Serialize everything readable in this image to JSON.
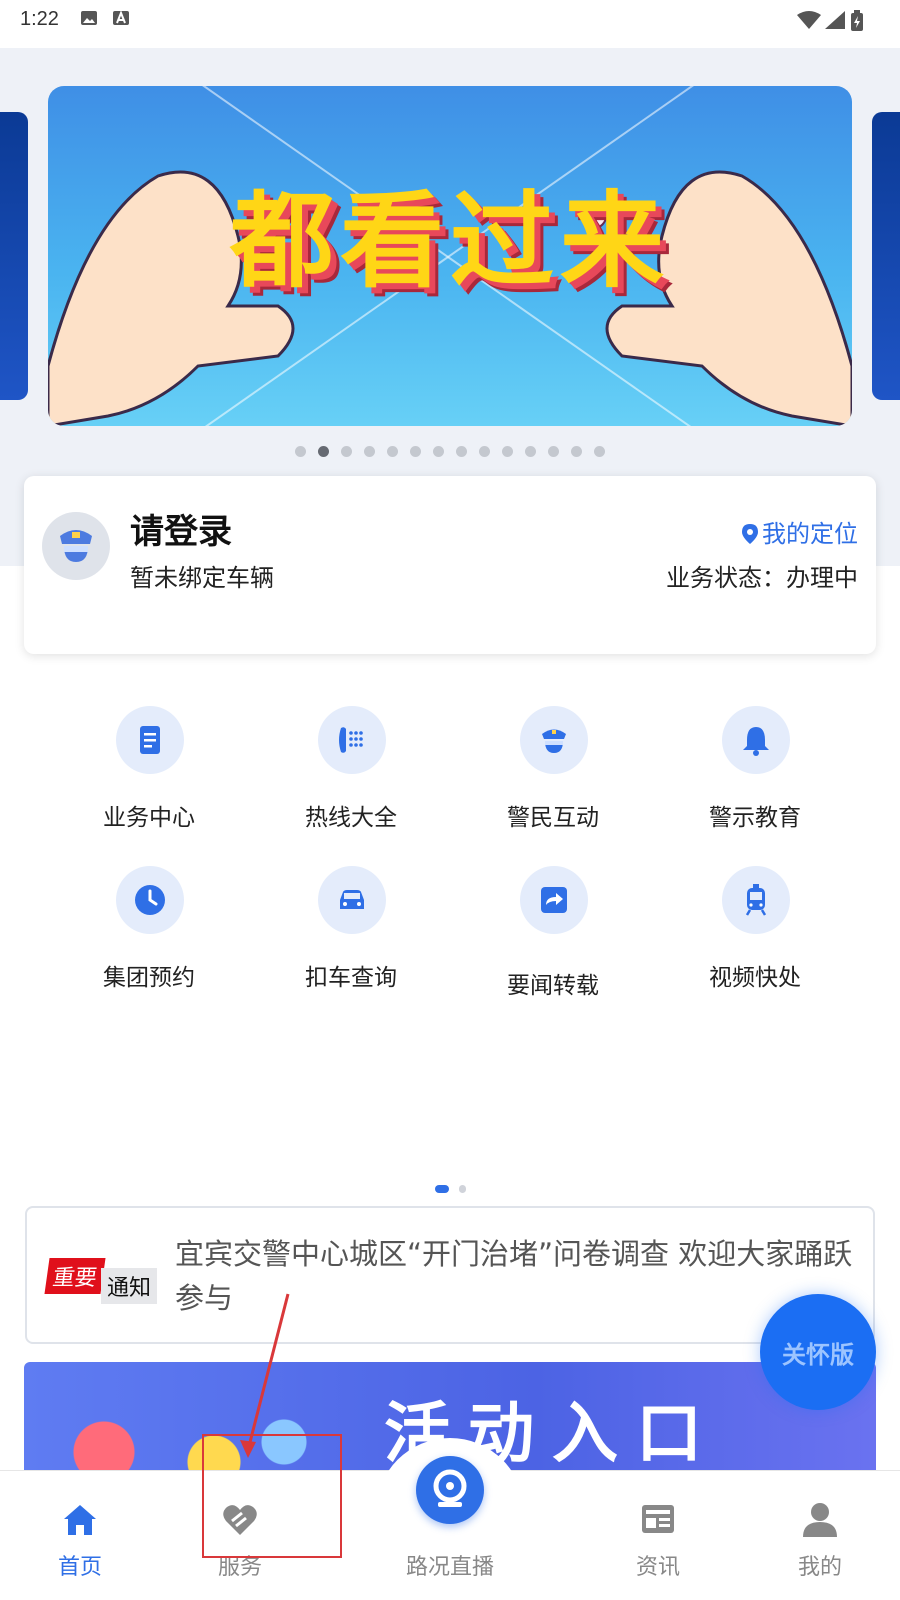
{
  "status_bar": {
    "time": "1:22"
  },
  "banner": {
    "title": "都看过来",
    "pages": 14,
    "active_page": 2
  },
  "login_card": {
    "title": "请登录",
    "subtitle": "暂未绑定车辆",
    "location_label": "我的定位",
    "status_text": "业务状态：办理中"
  },
  "services": [
    {
      "label": "业务中心",
      "icon": "document-icon"
    },
    {
      "label": "热线大全",
      "icon": "phone-icon"
    },
    {
      "label": "警民互动",
      "icon": "police-icon"
    },
    {
      "label": "警示教育",
      "icon": "bell-icon"
    },
    {
      "label": "集团预约",
      "icon": "clock-icon"
    },
    {
      "label": "扣车查询",
      "icon": "car-icon"
    },
    {
      "label": "要闻转载",
      "icon": "share-icon"
    },
    {
      "label": "视频快处",
      "icon": "tram-icon"
    }
  ],
  "services_pages": {
    "count": 2,
    "active": 1
  },
  "notice": {
    "badge_important": "重要",
    "badge_notice": "通知",
    "text": "宜宾交警中心城区“开门治堵”问卷调查  欢迎大家踊跃参与"
  },
  "care_button": {
    "label": "关怀版"
  },
  "activity": {
    "title": "活动入口"
  },
  "tab_bar": {
    "tabs": [
      {
        "label": "首页",
        "icon": "home-icon",
        "active": true
      },
      {
        "label": "服务",
        "icon": "service-icon",
        "active": false
      },
      {
        "label": "路况直播",
        "icon": "camera-icon",
        "active": false
      },
      {
        "label": "资讯",
        "icon": "news-icon",
        "active": false
      },
      {
        "label": "我的",
        "icon": "user-icon",
        "active": false
      }
    ]
  },
  "colors": {
    "accent": "#2f6fe6",
    "banner_text": "#ffd616",
    "important_red": "#e0101b",
    "annotation_red": "#d9383a"
  }
}
